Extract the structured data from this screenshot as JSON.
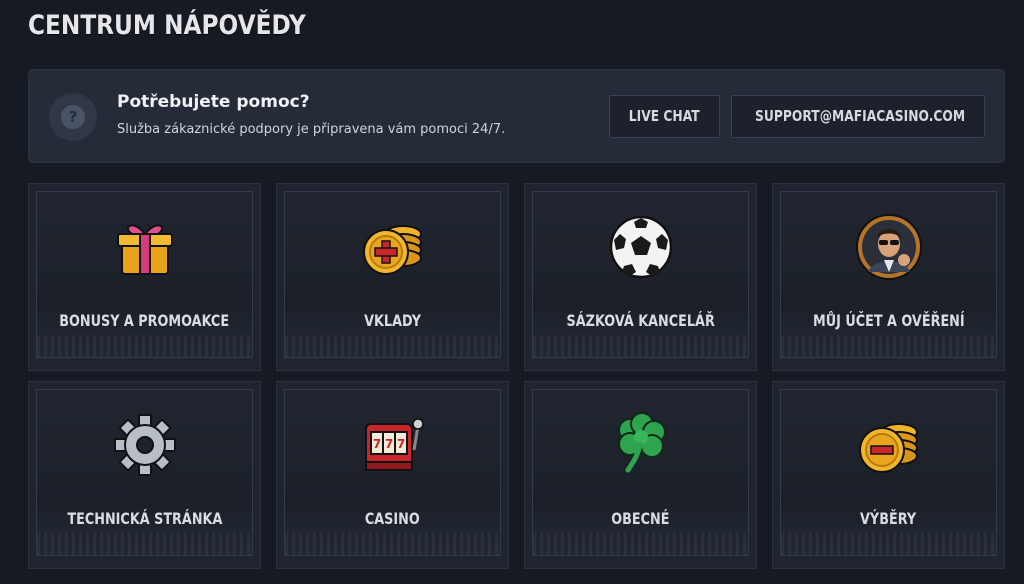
{
  "page": {
    "title": "CENTRUM NÁPOVĚDY"
  },
  "help_banner": {
    "icon": "question-icon",
    "icon_glyph": "?",
    "heading": "Potřebujete pomoc?",
    "subtext": "Služba zákaznické podpory je připravena vám pomoci 24/7.",
    "live_chat_label": "LIVE CHAT",
    "email_label": "SUPPORT@MAFIACASINO.COM"
  },
  "categories": [
    {
      "label": "BONUSY A PROMOAKCE",
      "icon": "gift-icon"
    },
    {
      "label": "VKLADY",
      "icon": "coins-plus-icon"
    },
    {
      "label": "SÁZKOVÁ KANCELÁŘ",
      "icon": "soccer-ball-icon"
    },
    {
      "label": "MŮJ ÚČET A OVĚŘENÍ",
      "icon": "avatar-icon"
    },
    {
      "label": "TECHNICKÁ STRÁNKA",
      "icon": "gear-icon"
    },
    {
      "label": "CASINO",
      "icon": "slot-machine-icon"
    },
    {
      "label": "OBECNÉ",
      "icon": "clover-icon"
    },
    {
      "label": "VÝBĚRY",
      "icon": "coins-minus-icon"
    }
  ],
  "colors": {
    "background": "#161a22",
    "banner": "#252b37",
    "card": "#1f2430",
    "gold": "#f0b429",
    "red": "#c8262b"
  }
}
